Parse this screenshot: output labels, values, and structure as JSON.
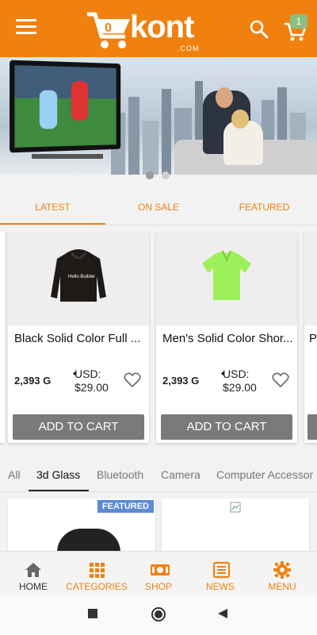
{
  "app": {
    "logo_text": "kont",
    "logo_sub": ".COM",
    "cart_count": "1",
    "colors": {
      "brand": "#f0810f",
      "badge": "#8bbf82",
      "featured": "#5b8ad6",
      "button": "#7a7a7a"
    }
  },
  "banner": {
    "slide_count": 2,
    "active_slide": 1
  },
  "tabs": [
    {
      "label": "LATEST"
    },
    {
      "label": "ON SALE"
    },
    {
      "label": "FEATURED"
    }
  ],
  "products": [
    {
      "name": "Black Solid Color Full ...",
      "price_g": "2,393 G",
      "usd_line1": "USD:",
      "usd_line2": "$29.00",
      "add_label": "ADD TO CART",
      "image_text": "Hello Builder"
    },
    {
      "name": "Men's Solid Color Shor...",
      "price_g": "2,393 G",
      "usd_line1": "USD:",
      "usd_line2": "$29.00",
      "add_label": "ADD TO CART"
    },
    {
      "name": "P"
    }
  ],
  "categories": [
    {
      "label": "All"
    },
    {
      "label": "3d Glass"
    },
    {
      "label": "Bluetooth"
    },
    {
      "label": "Camera"
    },
    {
      "label": "Computer Accessor"
    }
  ],
  "grid": {
    "featured_label": "FEATURED"
  },
  "bottom_nav": [
    {
      "label": "HOME",
      "icon": "home-icon"
    },
    {
      "label": "CATEGORIES",
      "icon": "categories-icon"
    },
    {
      "label": "SHOP",
      "icon": "shop-icon"
    },
    {
      "label": "NEWS",
      "icon": "news-icon"
    },
    {
      "label": "MENU",
      "icon": "gear-icon"
    }
  ]
}
